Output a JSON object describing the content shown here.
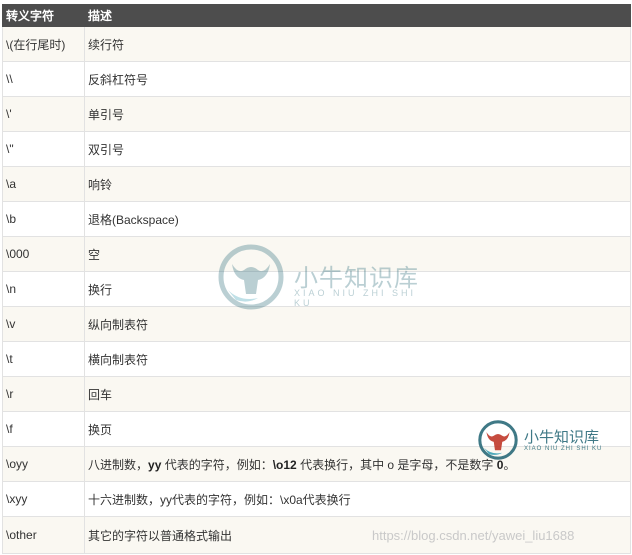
{
  "table": {
    "headers": [
      "转义字符",
      "描述"
    ],
    "rows": [
      {
        "char": "\\(在行尾时)",
        "desc": "续行符"
      },
      {
        "char": "\\\\",
        "desc": "反斜杠符号"
      },
      {
        "char": "\\'",
        "desc": "单引号"
      },
      {
        "char": "\\\"",
        "desc": "双引号"
      },
      {
        "char": "\\a",
        "desc": "响铃"
      },
      {
        "char": "\\b",
        "desc": "退格(Backspace)"
      },
      {
        "char": "\\000",
        "desc": "空"
      },
      {
        "char": "\\n",
        "desc": "换行"
      },
      {
        "char": "\\v",
        "desc": "纵向制表符"
      },
      {
        "char": "\\t",
        "desc": "横向制表符"
      },
      {
        "char": "\\r",
        "desc": "回车"
      },
      {
        "char": "\\f",
        "desc": "换页"
      },
      {
        "char": "\\oyy",
        "desc_parts": [
          "八进制数，",
          "yy",
          " 代表的字符，例如：",
          "\\o12",
          " 代表换行，其中 o 是字母，不是数字 ",
          "0",
          "。"
        ]
      },
      {
        "char": "\\xyy",
        "desc": "十六进制数，yy代表的字符，例如：\\x0a代表换行"
      },
      {
        "char": "\\other",
        "desc": "其它的字符以普通格式输出"
      }
    ]
  },
  "watermarks": {
    "center_text": "小牛知识库",
    "center_sub": "XIAO NIU ZHI SHI KU",
    "corner_text": "小牛知识库",
    "corner_sub": "XIAO NIU ZHI SHI KU",
    "url": "https://blog.csdn.net/yawei_liu1688"
  },
  "colors": {
    "header_bg": "#4d4d4d",
    "row_alt": "#faf8f2",
    "watermark": "#2b6b7a"
  }
}
